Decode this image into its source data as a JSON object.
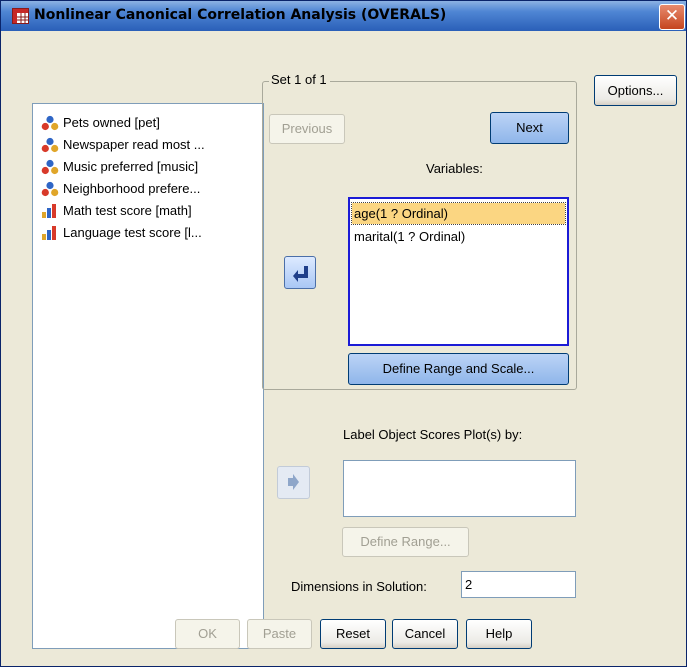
{
  "window": {
    "title": "Nonlinear Canonical Correlation Analysis (OVERALS)",
    "close_glyph": "✕"
  },
  "source_variables": [
    {
      "label": "Pets owned [pet]",
      "icon": "nominal-icon"
    },
    {
      "label": "Newspaper read most ...",
      "icon": "nominal-icon"
    },
    {
      "label": "Music preferred [music]",
      "icon": "nominal-icon"
    },
    {
      "label": "Neighborhood prefere...",
      "icon": "nominal-icon"
    },
    {
      "label": "Math test score [math]",
      "icon": "scale-icon"
    },
    {
      "label": "Language test score [l...",
      "icon": "scale-icon"
    }
  ],
  "set_group": {
    "legend": "Set 1 of 1",
    "previous_label": "Previous",
    "next_label": "Next",
    "variables_label": "Variables:",
    "variables": [
      "age(1 ? Ordinal)",
      "marital(1 ? Ordinal)"
    ],
    "selected_index": 0,
    "define_range_scale_label": "Define Range and Scale..."
  },
  "options_label": "Options...",
  "label_object": {
    "label": "Label Object Scores Plot(s) by:",
    "define_range_label": "Define Range...",
    "value": ""
  },
  "dimensions": {
    "label": "Dimensions in Solution:",
    "value": "2"
  },
  "footer": {
    "ok": "OK",
    "paste": "Paste",
    "reset": "Reset",
    "cancel": "Cancel",
    "help": "Help"
  },
  "colors": {
    "title_gradient_top": "#8db2e3",
    "title_gradient_bottom": "#2a5fb8",
    "close_button": "#c5451f",
    "selection_highlight": "#fbd682",
    "list_focus_border": "#1b1bd6",
    "dialog_background": "#ece9d8"
  }
}
